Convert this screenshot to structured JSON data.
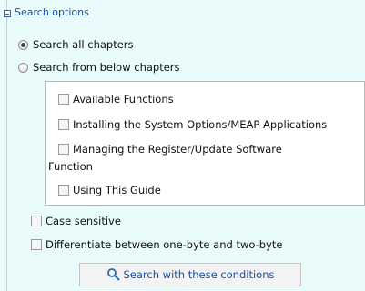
{
  "section": {
    "header": "Search options"
  },
  "scope": {
    "all_chapters": "Search all chapters",
    "below_chapters": "Search from below chapters",
    "selected": "all_chapters"
  },
  "chapters": [
    {
      "label": "Available Functions",
      "checked": false
    },
    {
      "label": "Installing the System Options/MEAP Applications",
      "checked": false
    },
    {
      "label": "Managing the Register/Update Software",
      "checked": false,
      "label_wrap": "Function"
    },
    {
      "label": "Using This Guide",
      "checked": false
    }
  ],
  "options": {
    "case_sensitive": "Case sensitive",
    "differentiate_bytes": "Differentiate between one-byte and two-byte"
  },
  "action": {
    "search_label": "Search with these conditions"
  }
}
